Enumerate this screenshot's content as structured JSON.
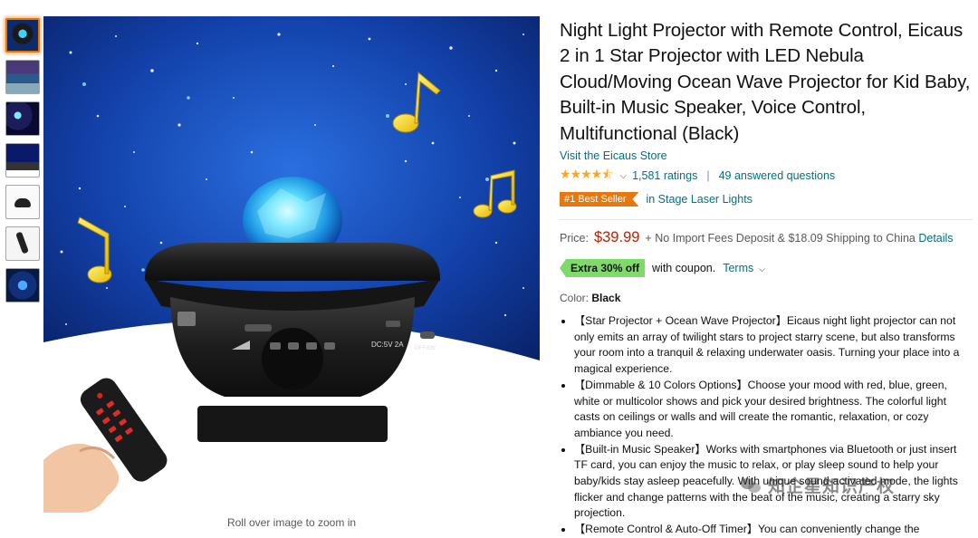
{
  "thumbnails": [
    {
      "name": "thumb-1",
      "active": true
    },
    {
      "name": "thumb-2",
      "active": false
    },
    {
      "name": "thumb-3",
      "active": false
    },
    {
      "name": "thumb-4",
      "active": false
    },
    {
      "name": "thumb-5",
      "active": false
    },
    {
      "name": "thumb-6",
      "active": false
    },
    {
      "name": "thumb-7",
      "active": false
    }
  ],
  "image": {
    "zoom_hint": "Roll over image to zoom in",
    "projector_labels": {
      "port": "DC:5V 2A",
      "switch": "OFF/ON"
    }
  },
  "product": {
    "title": "Night Light Projector with Remote Control, Eicaus 2 in 1 Star Projector with LED Nebula Cloud/Moving Ocean Wave Projector for Kid Baby, Built-in Music Speaker, Voice Control, Multifunctional (Black)",
    "store_link": "Visit the Eicaus Store",
    "rating_stars": 4.5,
    "ratings": "1,581 ratings",
    "answered": "49 answered questions",
    "badge": "#1 Best Seller",
    "category": "in Stage Laser Lights",
    "price_label": "Price:",
    "price": "$39.99",
    "fees": "+ No Import Fees Deposit & $18.09 Shipping to China",
    "details_link": "Details",
    "coupon_badge": "Extra 30% off",
    "coupon_text": "with coupon.",
    "terms": "Terms",
    "color_label": "Color:",
    "color_value": "Black",
    "bullets": [
      "【Star Projector + Ocean Wave Projector】Eicaus night light projector can not only emits an array of twilight stars to project starry scene, but also transforms your room into a tranquil & relaxing underwater oasis. Turning your place into a magical experience.",
      "【Dimmable & 10 Colors Options】Choose your mood with red, blue, green, white or multicolor shows and pick your desired brightness. The colorful light casts on ceilings or walls and will create the romantic, relaxation, or cozy ambiance you need.",
      "【Built-in Music Speaker】Works with smartphones via Bluetooth or just insert TF card, you can enjoy the music to relax, or play sleep sound to help your baby/kids stay asleep peacefully. With unique sound-activated mode, the lights flicker and change patterns with the beat of the music, creating a starry sky projection.",
      "【Remote Control & Auto-Off Timer】You can conveniently change the"
    ]
  },
  "watermark": "知企星知识产权",
  "colors": {
    "link": "#007185",
    "price": "#b12704",
    "badge": "#e47911",
    "coupon": "#7fda69",
    "star": "#ffa41c"
  }
}
